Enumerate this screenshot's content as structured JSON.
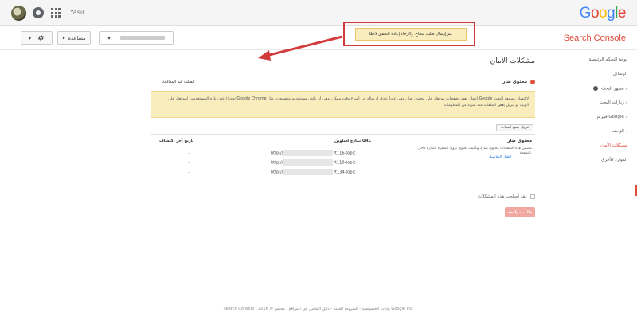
{
  "topbar": {
    "username": "Yasir",
    "logo_letters": [
      {
        "ch": "G",
        "color": "#4285F4"
      },
      {
        "ch": "o",
        "color": "#EA4335"
      },
      {
        "ch": "o",
        "color": "#FBBC05"
      },
      {
        "ch": "g",
        "color": "#4285F4"
      },
      {
        "ch": "l",
        "color": "#34A853"
      },
      {
        "ch": "e",
        "color": "#EA4335"
      }
    ]
  },
  "subbar": {
    "product_title": "Search Console",
    "help_label": "مساعدة",
    "gear_caret": "▾",
    "site_caret": "▾"
  },
  "notice": {
    "text": "تم إرسال طلبك بنجاح. والرجاء إعادة التحقق لاحقًا."
  },
  "sidebar": {
    "items": [
      {
        "label": "لوحة التحكم الرئيسية",
        "caret": "",
        "info": false,
        "active": false
      },
      {
        "label": "الرسائل",
        "caret": "",
        "info": false,
        "active": false
      },
      {
        "label": "مظهر البحث",
        "caret": "◂",
        "info": true,
        "active": false
      },
      {
        "label": "زيارات البحث",
        "caret": "◂",
        "info": false,
        "active": false
      },
      {
        "label": "فهرس Google",
        "caret": "◂",
        "info": false,
        "active": false
      },
      {
        "label": "الزحف",
        "caret": "◂",
        "info": false,
        "active": false
      },
      {
        "label": "مشكلات الأمان",
        "caret": "",
        "info": false,
        "active": true
      },
      {
        "label": "الموارد الأخرى",
        "caret": "",
        "info": false,
        "active": false
      }
    ]
  },
  "main": {
    "page_title": "مشكلات الأمان",
    "issue_name": "محتوى ضار",
    "request_review_heading": "الطلب قيد المعالجة",
    "warning_text": "لاكتشاف سمعة البحث Google اتصال بعض صفحات موقعك على محتوى ضار، وهي عادةً تؤدي لإرساله في أسرع وقت ممكن. وهي أن تكون مستخدمو متصفحات مثل Google Chrome تحذيرًا عند زيارة المستخدمين لموقعك على الويب أو تنزيل بعض الملفات منه. مزيد من المعلومات",
    "download_button": "تنزيل جميع العينات",
    "col_urls": "نماذج لعناوين URL",
    "col_date": "تاريخ آخر اكتشاف",
    "issue_type": "محتوى ضار",
    "issue_desc": "تتضمن هذه الصفحات محتوى ضارًا، وتأكيف تحتوي نزول الشفرة الضارة داخل الصفحة.",
    "show_details": "إظهار التفاصيل",
    "urls": [
      {
        "prefix": "http://",
        "suffix": "/t116-topic",
        "date": "-"
      },
      {
        "prefix": "http://",
        "suffix": "/t118-topic",
        "date": "-"
      },
      {
        "prefix": "http://",
        "suffix": "/t134-topic",
        "date": "-"
      }
    ],
    "checkbox_label": "لقد أصلحت هذه المشكلات",
    "review_button": "طلب مراجعة"
  },
  "footer": {
    "text": "Search Console - بيانات الخصوصية - الشروط العامة - دليل الشامل عن المواقع - مجتمع © 2016 Google Inc."
  },
  "colors": {
    "accent_red": "#dd4b39",
    "notice_bg": "#f9edbe",
    "highlight_frame": "#d23b3b"
  }
}
